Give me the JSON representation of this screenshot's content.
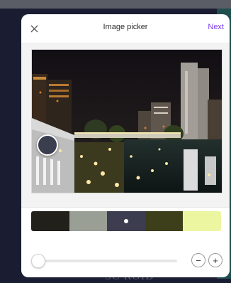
{
  "modal": {
    "title": "Image picker",
    "next_label": "Next",
    "close_icon": "close-icon",
    "accent_color": "#7a3cf0"
  },
  "background": {
    "partial_text": "SC ROID"
  },
  "palette": {
    "swatches": [
      {
        "name": "swatch-1",
        "color": "#22201b"
      },
      {
        "name": "swatch-2",
        "color": "#9a9f96"
      },
      {
        "name": "swatch-3",
        "color": "#3c3d4f",
        "selected": true
      },
      {
        "name": "swatch-4",
        "color": "#3c3f1a"
      },
      {
        "name": "swatch-5",
        "color": "#ecf6a0"
      }
    ]
  },
  "zoom": {
    "minus_label": "−",
    "plus_label": "+",
    "level_fraction": 0.0
  }
}
